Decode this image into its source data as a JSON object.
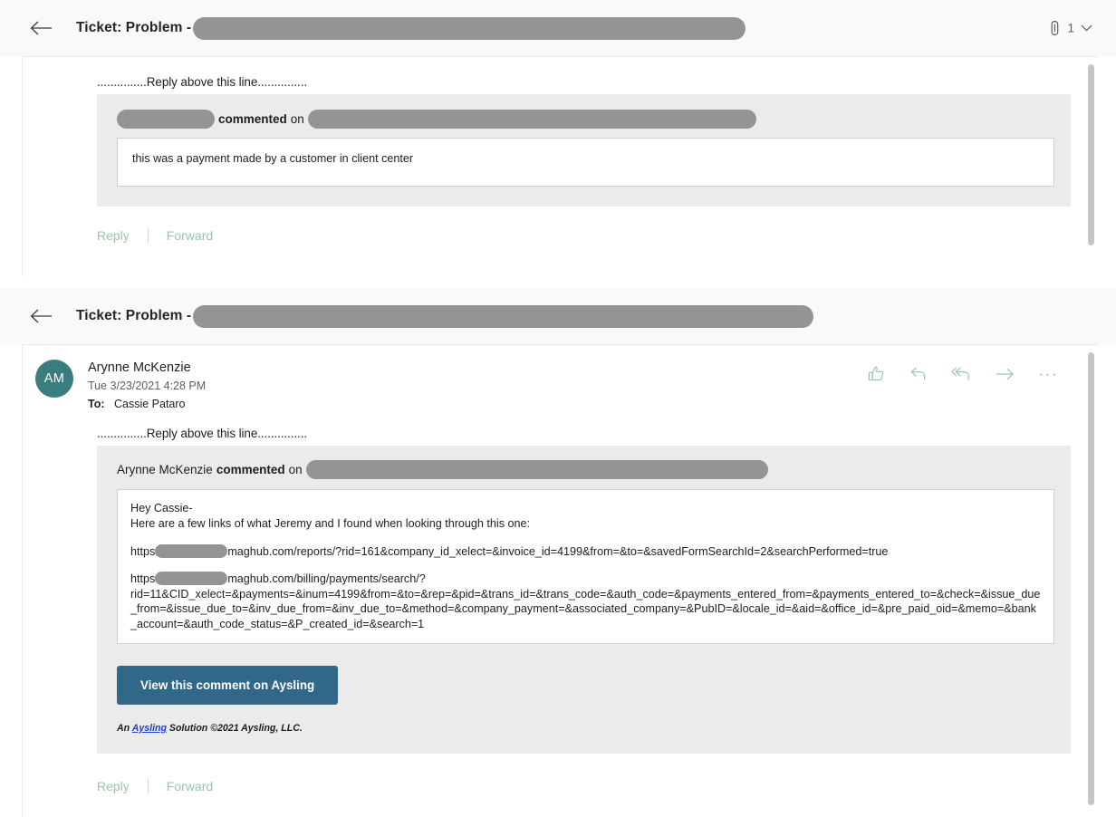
{
  "panels": [
    {
      "id": "panel-top",
      "header": {
        "back_icon": "back-arrow-icon",
        "title": "Ticket: Problem -",
        "attachment_icon": "paperclip-icon",
        "attachment_count": "1",
        "expand_icon": "chevron-down-icon"
      },
      "body": {
        "reply_above_line": "...............Reply above this line...............",
        "commented_prefix": "",
        "commented_bold": "commented",
        "commented_suffix": "on",
        "message_text": "this was a payment made by a customer in client center"
      },
      "footer": {
        "reply_label": "Reply",
        "forward_label": "Forward"
      }
    },
    {
      "id": "panel-bottom",
      "header": {
        "back_icon": "back-arrow-icon",
        "title": "Ticket: Problem -"
      },
      "meta": {
        "avatar_initials": "AM",
        "sender_name": "Arynne McKenzie",
        "sent_date": "Tue 3/23/2021 4:28 PM",
        "to_label": "To:",
        "to_recipients": "Cassie Pataro",
        "actions": [
          {
            "name": "like-icon",
            "label": "Like"
          },
          {
            "name": "reply-icon",
            "label": "Reply"
          },
          {
            "name": "reply-all-icon",
            "label": "Reply all"
          },
          {
            "name": "forward-icon",
            "label": "Forward"
          },
          {
            "name": "more-actions-icon",
            "label": "More actions"
          }
        ]
      },
      "body": {
        "reply_above_line": "...............Reply above this line...............",
        "commented_prefix": "Arynne McKenzie",
        "commented_bold": "commented",
        "commented_suffix": "on",
        "greeting": "Hey Cassie-",
        "intro": "Here are a few links of what Jeremy and I found when looking through this one:",
        "link1_prefix": "https",
        "link1_rest": "maghub.com/reports/?rid=161&company_id_xelect=&invoice_id=4199&from=&to=&savedFormSearchId=2&searchPerformed=true",
        "link2_prefix": "https",
        "link2_rest": "maghub.com/billing/payments/search/?",
        "link2_query": "rid=11&CID_xelect=&payments=&inum=4199&from=&to=&rep=&pid=&trans_id=&trans_code=&auth_code=&payments_entered_from=&payments_entered_to=&check=&issue_due_from=&issue_due_to=&inv_due_from=&inv_due_to=&method=&company_payment=&associated_company=&PubID=&locale_id=&aid=&office_id=&pre_paid_oid=&memo=&bank_account=&auth_code_status=&P_created_id=&search=1",
        "cta_label": "View this comment on Aysling",
        "footer_pre": "An",
        "footer_link": "Aysling",
        "footer_post": "Solution ©2021 Aysling, LLC."
      },
      "footer": {
        "reply_label": "Reply",
        "forward_label": "Forward"
      }
    }
  ],
  "colors": {
    "accent_green": "#9cc4ac",
    "avatar_teal": "#3a7d7e",
    "cta_blue": "#31688a",
    "redaction_grey": "#949494",
    "panel_header_bg": "#faf9f8",
    "block_bg": "#ebebeb"
  }
}
